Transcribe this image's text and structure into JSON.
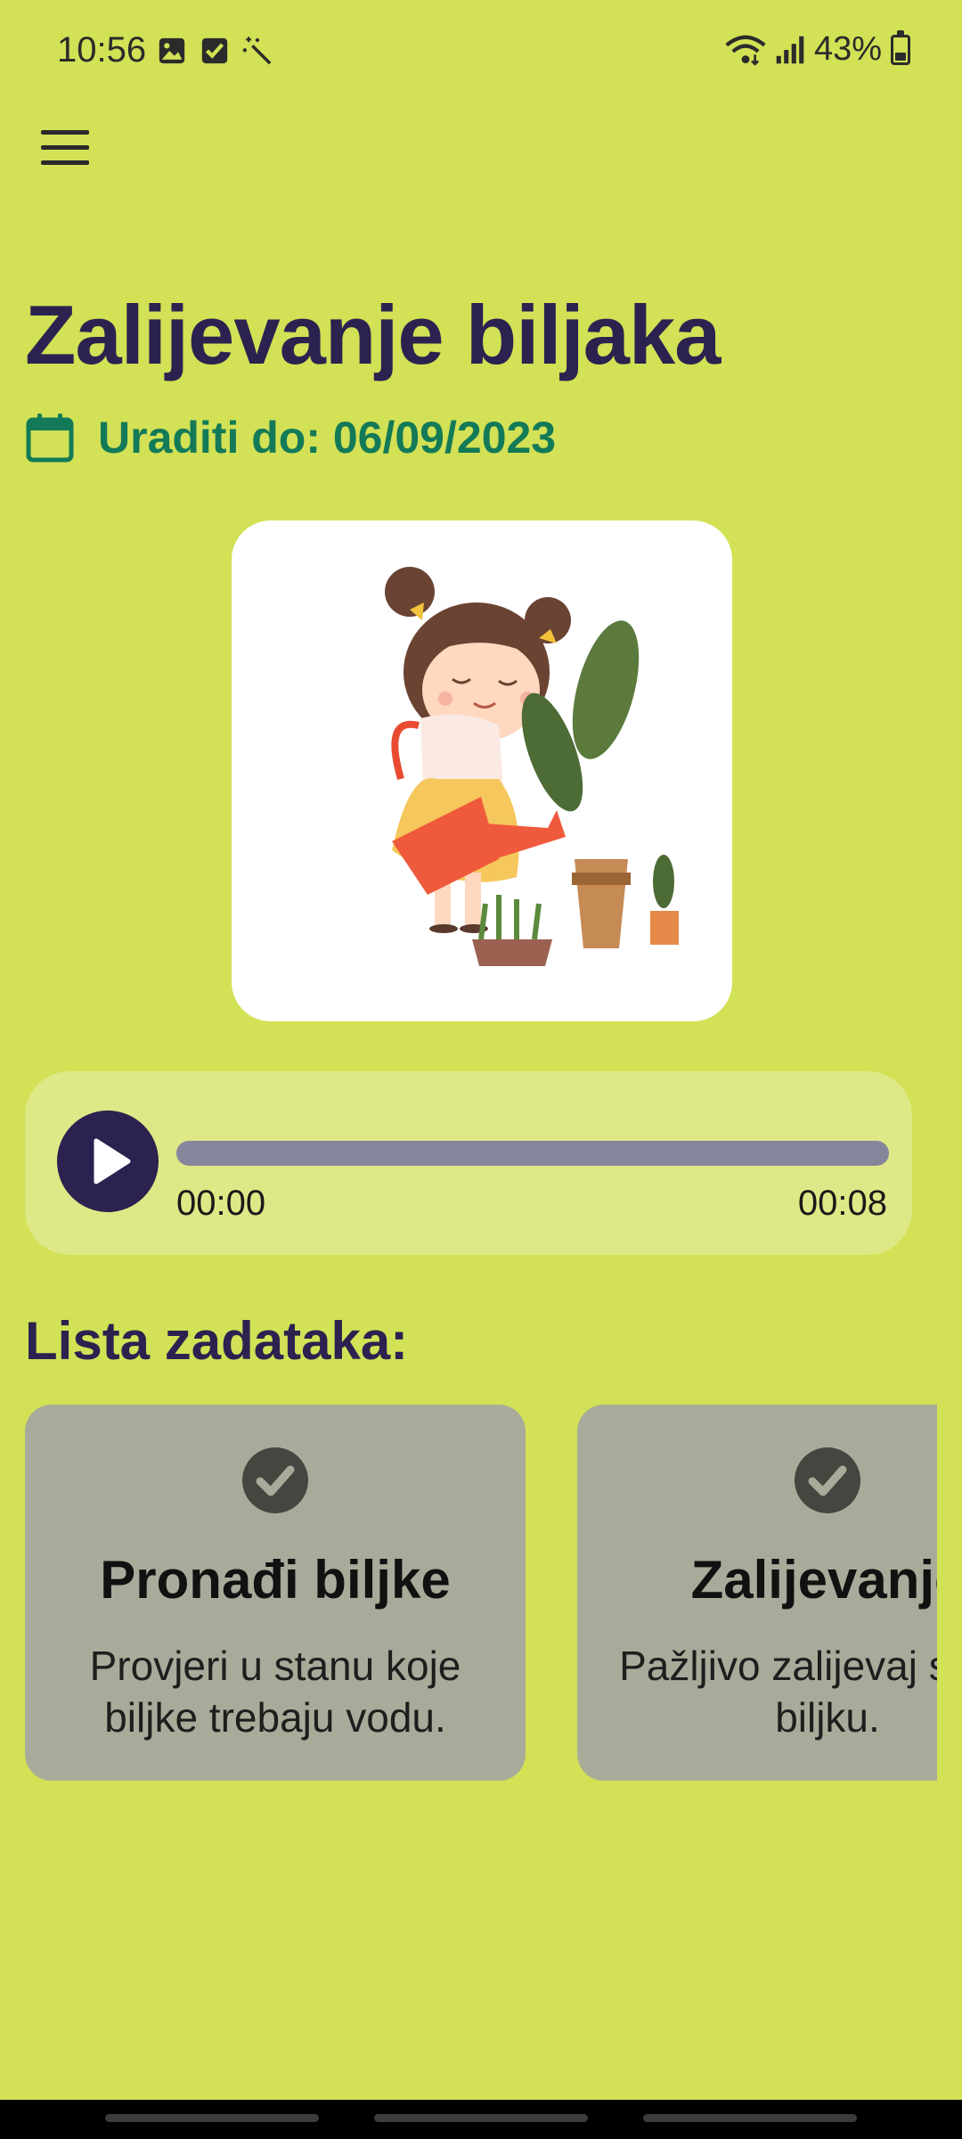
{
  "status_bar": {
    "time": "10:56",
    "left_icons": [
      "image-icon",
      "checkbox-icon",
      "magic-wand-icon"
    ],
    "right_icons": [
      "wifi-icon",
      "signal-icon"
    ],
    "battery_percent_text": "43%",
    "battery_level": 0.43
  },
  "header": {
    "menu_icon": "hamburger-menu-icon"
  },
  "main": {
    "title": "Zalijevanje biljaka",
    "due_date_text": "Uraditi do: 06/09/2023",
    "illustration": "girl-watering-plants-illustration"
  },
  "audio_player": {
    "current_time": "00:00",
    "total_time": "00:08",
    "progress": 0.0
  },
  "task_section": {
    "heading": "Lista zadataka:",
    "tasks": [
      {
        "title": "Pronađi biljke",
        "description": "Provjeri u stanu koje biljke trebaju vodu.",
        "done": true
      },
      {
        "title": "Zalijevanje",
        "description": "Pažljivo zalijevaj svaku biljku.",
        "done": true
      }
    ]
  },
  "colors": {
    "background": "#d2e155",
    "primary": "#2c2250",
    "due_date": "#137a58",
    "card": "#a9ab9a",
    "player_background": "#dfe886",
    "progress_track": "#85869c"
  }
}
